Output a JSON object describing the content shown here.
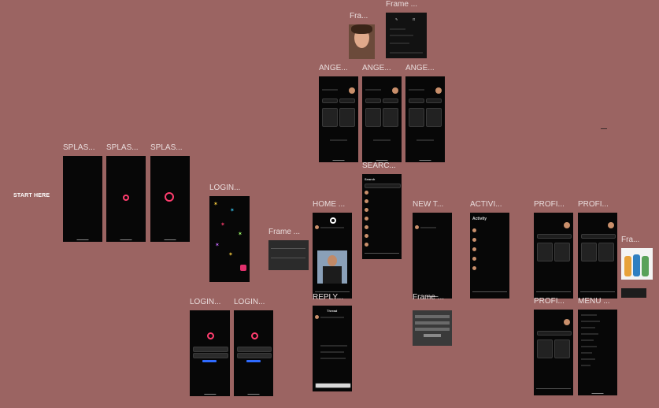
{
  "canvas": {
    "start_label": "START HERE"
  },
  "frames": {
    "fra_top": "Fra...",
    "frame_top": "Frame ...",
    "ange1": "ANGE...",
    "ange2": "ANGE...",
    "ange3": "ANGE...",
    "splash1": "SPLAS...",
    "splash2": "SPLAS...",
    "splash3": "SPLAS...",
    "search": "SEARC...",
    "login_top": "LOGIN...",
    "frame_mid": "Frame ...",
    "home": "HOME ...",
    "new_thread": "NEW T...",
    "activity": "ACTIVI...",
    "profile1": "PROFI...",
    "profile2": "PROFI...",
    "fra_right": "Fra...",
    "login1": "LOGIN...",
    "login2": "LOGIN...",
    "reply": "REPLY...",
    "frame_kb": "Frame ...",
    "profile3": "PROFI...",
    "menu": "MENU ..."
  },
  "screens": {
    "search_title": "Search",
    "activity_title": "Activity",
    "reply_title": "Thread"
  },
  "colors": {
    "canvas_bg": "#9b6462",
    "frame_bg": "#070707",
    "accent": "#ff3d6e"
  }
}
